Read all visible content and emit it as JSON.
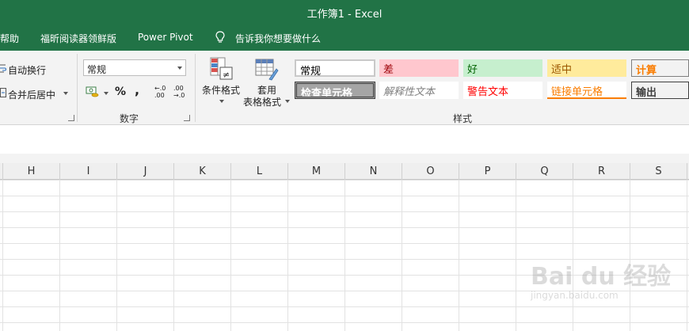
{
  "window": {
    "title": "工作簿1  -  Excel"
  },
  "menu": {
    "help": "帮助",
    "foxit": "福昕阅读器领鲜版",
    "power_pivot": "Power Pivot",
    "tell_me": "告诉我你想要做什么"
  },
  "alignment": {
    "wrap_text": "自动换行",
    "merge_center": "合并后居中"
  },
  "number": {
    "format": "常规",
    "percent": "%",
    "comma": ",",
    "inc_decimal": "←.0 .00",
    "dec_decimal": ".00 →.0",
    "group_label": "数字"
  },
  "commands": {
    "conditional_formatting": "条件格式",
    "format_as_table_1": "套用",
    "format_as_table_2": "表格格式"
  },
  "styles": {
    "group_label": "样式",
    "cells": [
      {
        "label": "常规",
        "bg": "#ffffff",
        "fg": "#000000"
      },
      {
        "label": "差",
        "bg": "#ffc7ce",
        "fg": "#9c0006"
      },
      {
        "label": "好",
        "bg": "#c6efce",
        "fg": "#006100"
      },
      {
        "label": "适中",
        "bg": "#ffeb9c",
        "fg": "#9c5700"
      },
      {
        "label": "计算",
        "bg": "#f2f2f2",
        "fg": "#fa7d00"
      },
      {
        "label": "检查单元格",
        "bg": "#a5a5a5",
        "fg": "#ffffff"
      },
      {
        "label": "解释性文本",
        "bg": "#ffffff",
        "fg": "#7f7f7f"
      },
      {
        "label": "警告文本",
        "bg": "#ffffff",
        "fg": "#ff0000"
      },
      {
        "label": "链接单元格",
        "bg": "#ffffff",
        "fg": "#fa7d00"
      },
      {
        "label": "输出",
        "bg": "#f2f2f2",
        "fg": "#3f3f3f"
      }
    ]
  },
  "columns": [
    "H",
    "I",
    "J",
    "K",
    "L",
    "M",
    "N",
    "O",
    "P",
    "Q",
    "R",
    "S"
  ],
  "watermark": {
    "brand": "Bai du 经验",
    "url": "jingyan.baidu.com"
  },
  "colors": {
    "accent": "#217346"
  }
}
